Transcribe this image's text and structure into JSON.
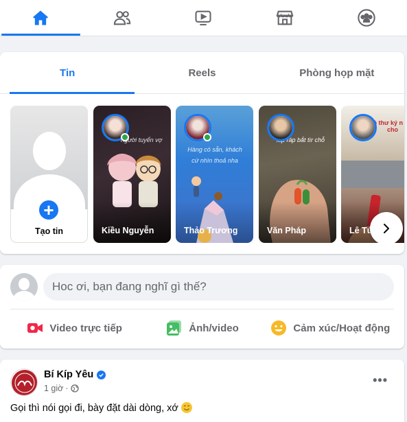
{
  "nav": {
    "tabs": [
      {
        "name": "home",
        "icon": "home-icon",
        "active": true
      },
      {
        "name": "friends",
        "icon": "friends-icon",
        "active": false
      },
      {
        "name": "watch",
        "icon": "video-icon",
        "active": false
      },
      {
        "name": "marketplace",
        "icon": "store-icon",
        "active": false
      },
      {
        "name": "groups",
        "icon": "groups-icon",
        "active": false
      }
    ]
  },
  "stories_card": {
    "tabs": [
      {
        "label": "Tin",
        "active": true
      },
      {
        "label": "Reels",
        "active": false
      },
      {
        "label": "Phòng họp mặt",
        "active": false
      }
    ],
    "create_label": "Tạo tin",
    "stories": [
      {
        "name": "Kiều Nguyễn",
        "online": true,
        "caption": "người tuyển vợ"
      },
      {
        "name": "Thảo Trương",
        "online": true,
        "caption": "Hàng có sẵn, khách cứ nhìn thoả nha"
      },
      {
        "name": "Văn Pháp",
        "online": false,
        "caption": "lắp ráp bắt tìr chỗ"
      },
      {
        "name": "Lê Tứ",
        "online": false,
        "caption": "cô thư ký n qua cho"
      }
    ]
  },
  "composer": {
    "placeholder": "Hoc ơi, bạn đang nghĩ gì thế?",
    "actions": [
      {
        "label": "Video trực tiếp",
        "icon": "live-video-icon",
        "color": "#f02849"
      },
      {
        "label": "Ảnh/video",
        "icon": "photo-icon",
        "color": "#45bd62"
      },
      {
        "label": "Cảm xúc/Hoạt động",
        "icon": "feeling-icon",
        "color": "#f7b928"
      }
    ]
  },
  "post": {
    "author": "Bí Kíp Yêu",
    "verified": true,
    "time": "1 giờ",
    "privacy_icon": "globe-icon",
    "text": "Gọi thì nói gọi đi, bày đặt dài dòng, xớ"
  },
  "colors": {
    "accent": "#1877f2",
    "background": "#f0f2f5",
    "secondary_text": "#65676b"
  }
}
